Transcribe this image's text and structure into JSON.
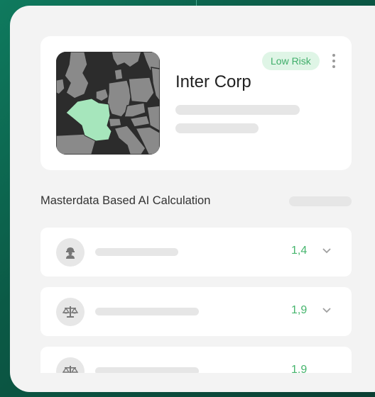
{
  "company": {
    "name": "Inter Corp",
    "risk_badge": "Low Risk",
    "country_highlight": "France",
    "map_highlight_color": "#a6e6bc"
  },
  "section": {
    "title": "Masterdata Based AI Calculation"
  },
  "rows": [
    {
      "icon": "worker-icon",
      "score": "1,4"
    },
    {
      "icon": "scales-icon",
      "score": "1,9"
    },
    {
      "icon": "scales-icon",
      "score": "1,9"
    }
  ],
  "colors": {
    "accent_green": "#46b56d",
    "badge_bg": "#dff5e6",
    "panel_bg": "#f3f3f3"
  }
}
